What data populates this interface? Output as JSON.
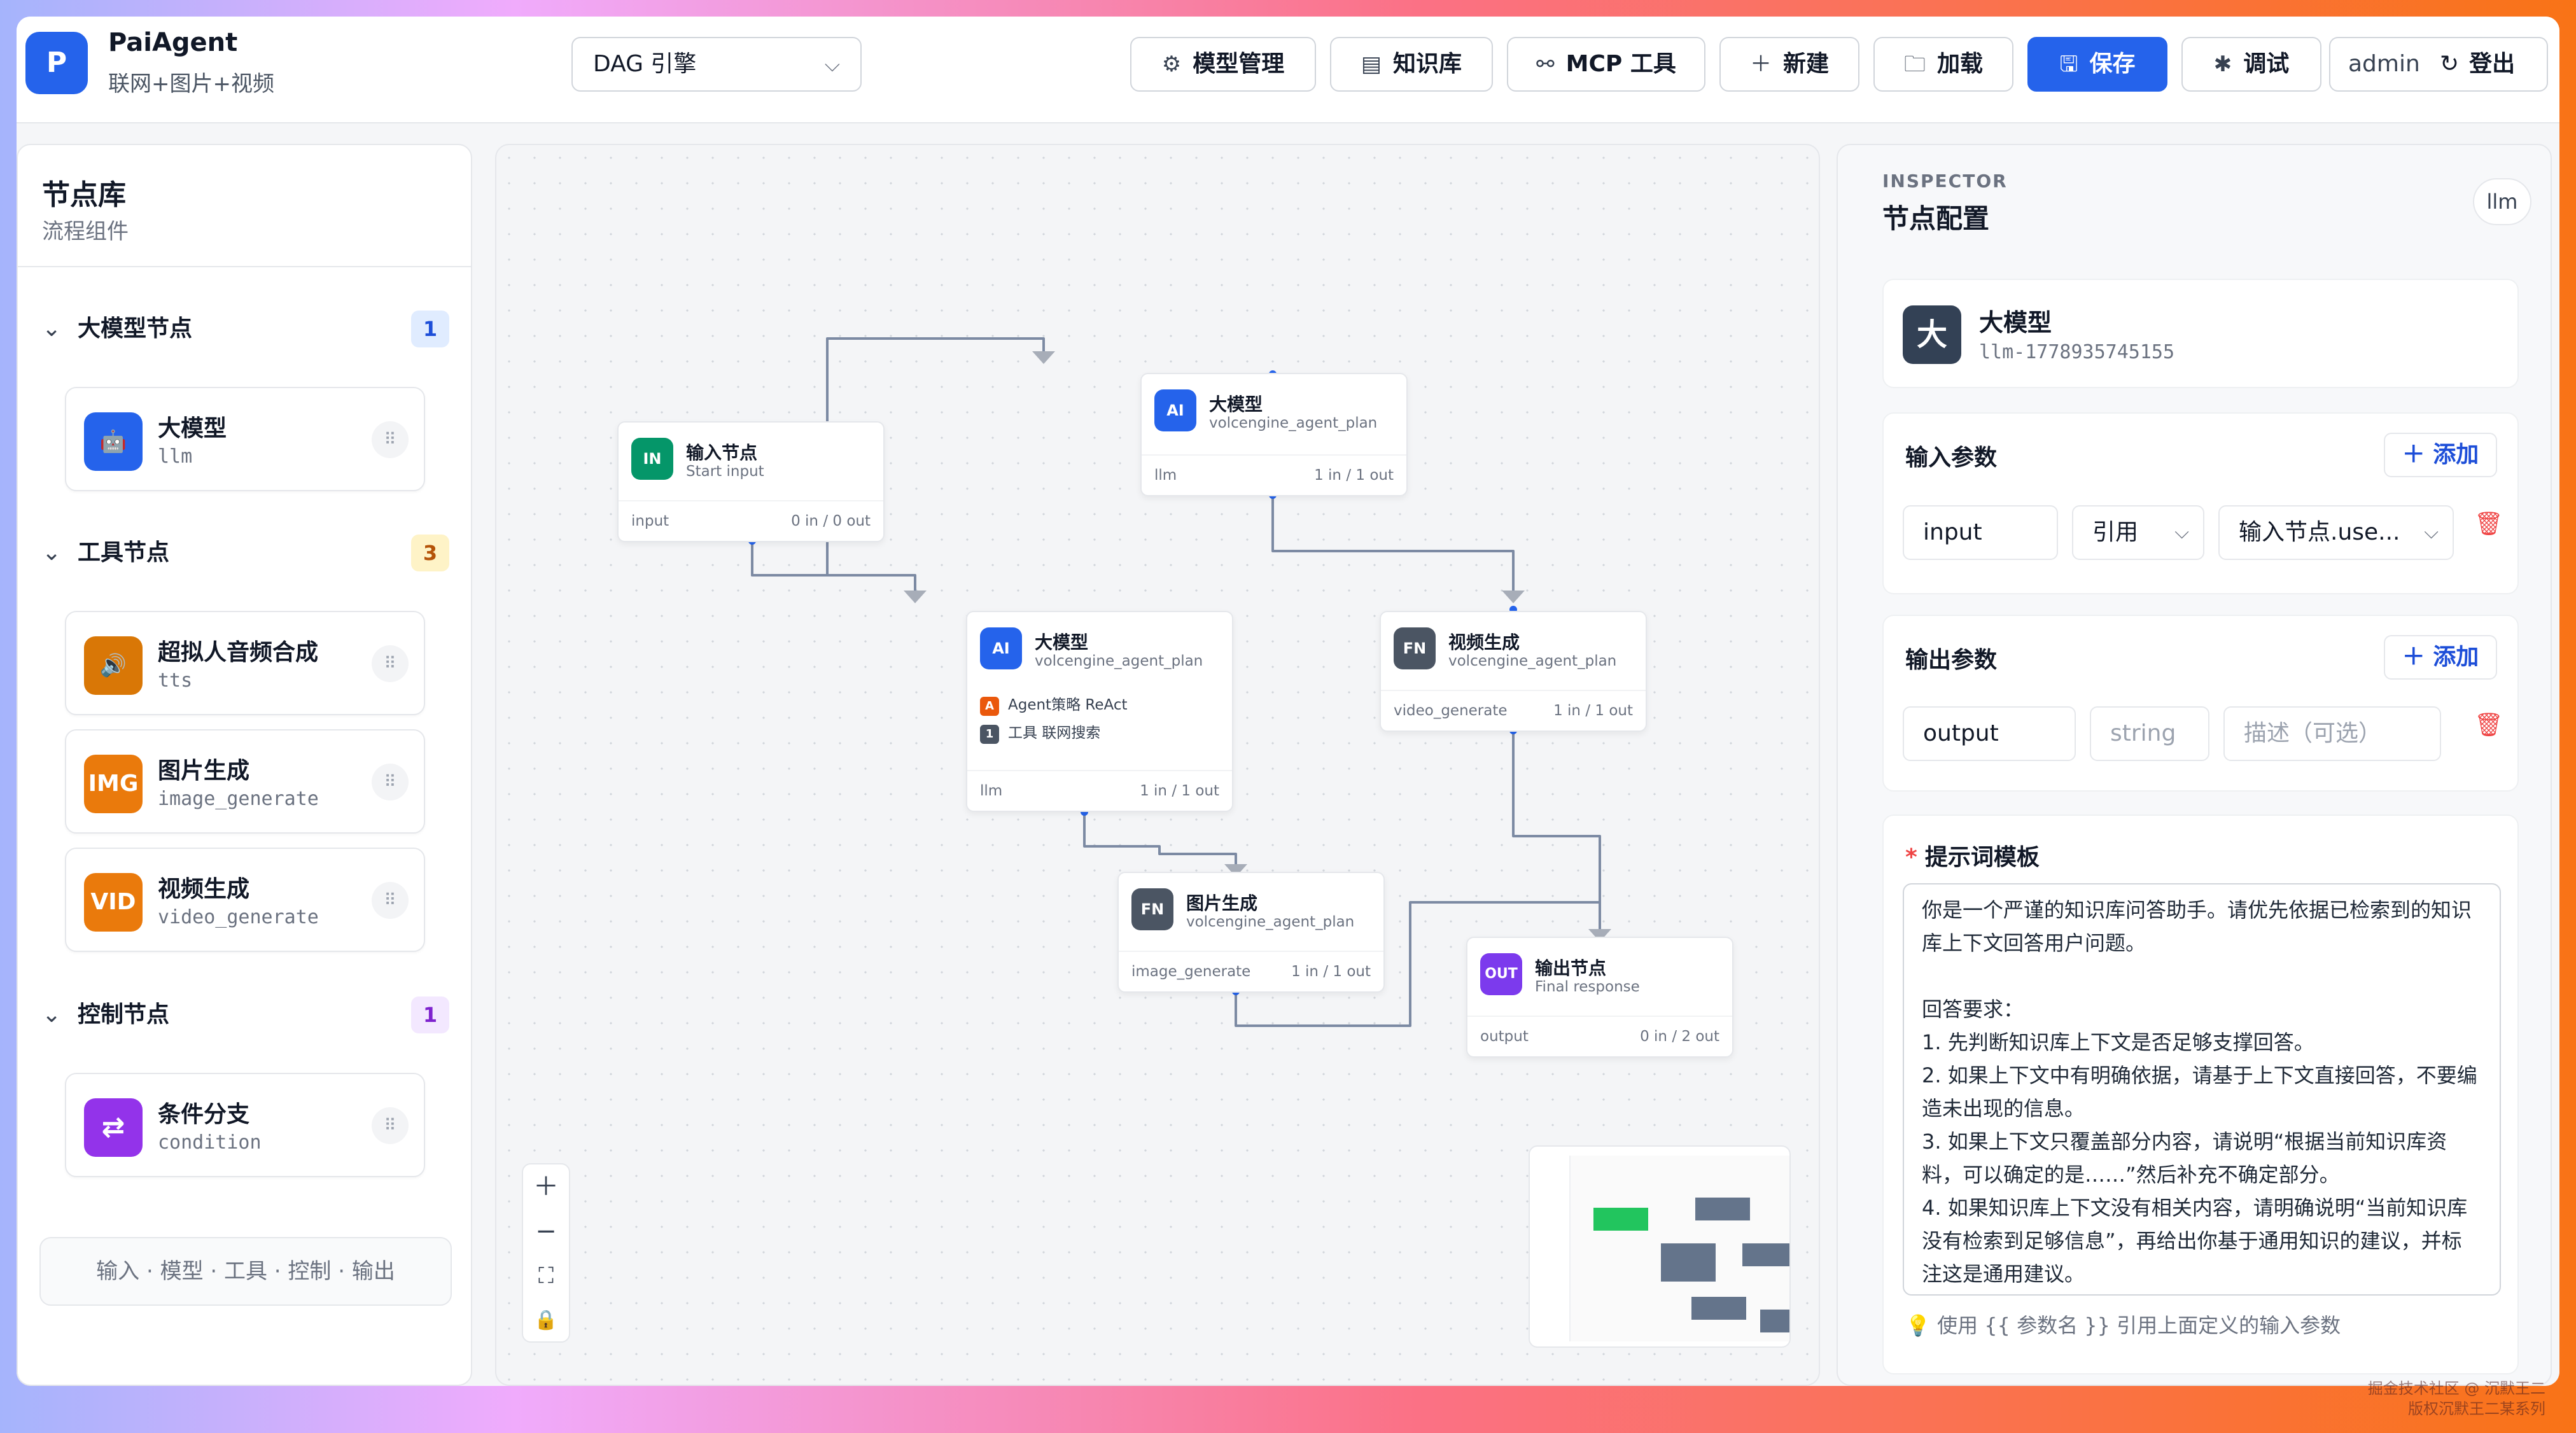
{
  "app": {
    "logo_letter": "P",
    "name": "PaiAgent",
    "subtitle": "联网+图片+视频"
  },
  "header": {
    "engine": "DAG 引擎",
    "buttons": {
      "models": "模型管理",
      "kb": "知识库",
      "mcp": "MCP 工具",
      "new": "新建",
      "load": "加载",
      "save": "保存",
      "debug": "调试"
    },
    "user": "admin",
    "logout": "登出"
  },
  "library": {
    "title": "节点库",
    "subtitle": "流程组件",
    "categories": [
      {
        "name": "大模型节点",
        "count": "1"
      },
      {
        "name": "工具节点",
        "count": "3"
      },
      {
        "name": "控制节点",
        "count": "1"
      }
    ],
    "items": [
      {
        "icon": "robot-icon",
        "icon_text": "🤖",
        "name": "大模型",
        "type": "llm",
        "color": "#2563eb"
      },
      {
        "icon": "speaker-icon",
        "icon_text": "🔊",
        "name": "超拟人音频合成",
        "type": "tts",
        "color": "#d97706"
      },
      {
        "icon": "image-icon",
        "icon_text": "IMG",
        "name": "图片生成",
        "type": "image_generate",
        "color": "#ea7a0c"
      },
      {
        "icon": "video-icon",
        "icon_text": "VID",
        "name": "视频生成",
        "type": "video_generate",
        "color": "#ea7a0c"
      },
      {
        "icon": "branch-icon",
        "icon_text": "⇄",
        "name": "条件分支",
        "type": "condition",
        "color": "#9333ea"
      }
    ],
    "footer": "输入 · 模型 · 工具 · 控制 · 输出"
  },
  "canvas": {
    "nodes": [
      {
        "badge": "IN",
        "badge_color": "#059669",
        "title": "输入节点",
        "subtitle": "Start input",
        "foot_left": "input",
        "foot_right": "0 in / 0 out"
      },
      {
        "badge": "AI",
        "badge_color": "#2563eb",
        "title": "大模型",
        "subtitle": "volcengine_agent_plan",
        "foot_left": "llm",
        "foot_right": "1 in / 1 out"
      },
      {
        "badge": "AI",
        "badge_color": "#2563eb",
        "title": "大模型",
        "subtitle": "volcengine_agent_plan",
        "foot_left": "llm",
        "foot_right": "1 in / 1 out",
        "rows": [
          {
            "mark": "A",
            "mark_color": "#ea580c",
            "text": "Agent策略 ReAct"
          },
          {
            "mark": "1",
            "mark_color": "#4b5563",
            "text": "工具 联网搜索"
          }
        ]
      },
      {
        "badge": "FN",
        "badge_color": "#4b5563",
        "title": "视频生成",
        "subtitle": "volcengine_agent_plan",
        "foot_left": "video_generate",
        "foot_right": "1 in / 1 out"
      },
      {
        "badge": "FN",
        "badge_color": "#4b5563",
        "title": "图片生成",
        "subtitle": "volcengine_agent_plan",
        "foot_left": "image_generate",
        "foot_right": "1 in / 1 out"
      },
      {
        "badge": "OUT",
        "badge_color": "#7c3aed",
        "title": "输出节点",
        "subtitle": "Final response",
        "foot_left": "output",
        "foot_right": "0 in / 2 out"
      }
    ]
  },
  "inspector": {
    "label": "INSPECTOR",
    "title": "节点配置",
    "tag": "llm",
    "node_avatar": "大",
    "node_name": "大模型",
    "node_id": "llm-1778935745155",
    "input_section": "输入参数",
    "add_label": "添加",
    "input_param": {
      "name": "input",
      "mode": "引用",
      "ref": "输入节点.use..."
    },
    "output_section": "输出参数",
    "output_param": {
      "name": "output",
      "type_placeholder": "string",
      "desc_placeholder": "描述（可选）"
    },
    "prompt_title": "提示词模板",
    "prompt_text": "你是一个严谨的知识库问答助手。请优先依据已检索到的知识库上下文回答用户问题。\n\n回答要求：\n1. 先判断知识库上下文是否足够支撑回答。\n2. 如果上下文中有明确依据，请基于上下文直接回答，不要编造未出现的信息。\n3. 如果上下文只覆盖部分内容，请说明“根据当前知识库资料，可以确定的是……”然后补充不确定部分。\n4. 如果知识库上下文没有相关内容，请明确说明“当前知识库没有检索到足够信息”，再给出你基于通用知识的建议，并标注这是通用建议。",
    "hint": "使用 {{ 参数名 }} 引用上面定义的输入参数"
  },
  "watermark": {
    "line1": "掘金技术社区 @ 沉默王二",
    "line2": "版权沉默王二某系列"
  }
}
